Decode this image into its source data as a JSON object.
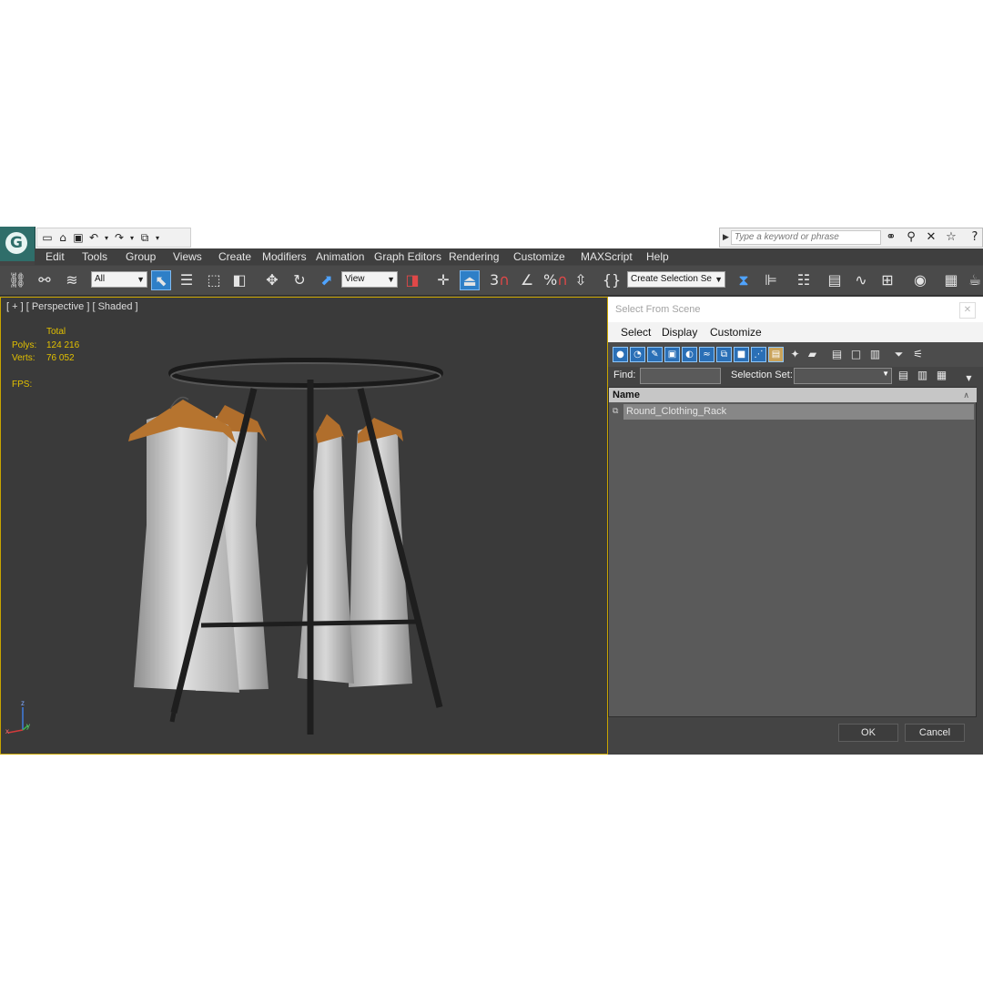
{
  "quick_access": {
    "icons": [
      "new-file-icon",
      "open-folder-icon",
      "save-icon",
      "undo-icon",
      "redo-icon",
      "project-folder-icon"
    ],
    "search_placeholder": "Type a keyword or phrase"
  },
  "menu": {
    "items": [
      "Edit",
      "Tools",
      "Group",
      "Views",
      "Create",
      "Modifiers",
      "Animation",
      "Graph Editors",
      "Rendering",
      "Customize",
      "MAXScript",
      "Help"
    ]
  },
  "toolbar": {
    "selection_filter": "All",
    "reference_coord": "View",
    "named_selection": "Create Selection Se",
    "snap_labels": {
      "snap3": "3",
      "percent": "%"
    }
  },
  "viewport": {
    "label": "[ + ] [ Perspective ] [ Shaded ]",
    "stats": {
      "total_label": "Total",
      "polys_label": "Polys:",
      "polys_value": "124 216",
      "verts_label": "Verts:",
      "verts_value": "76 052",
      "fps_label": "FPS:"
    },
    "axes": {
      "x": "x",
      "y": "y",
      "z": "z"
    }
  },
  "dialog": {
    "title": "Select From Scene",
    "menu": [
      "Select",
      "Display",
      "Customize"
    ],
    "find_label": "Find:",
    "selection_set_label": "Selection Set:",
    "column_header": "Name",
    "items": [
      {
        "name": "Round_Clothing_Rack"
      }
    ],
    "ok_label": "OK",
    "cancel_label": "Cancel"
  },
  "colors": {
    "viewport_bg": "#3a3a3a",
    "viewport_border": "#c8a400",
    "stats_text": "#e2c000",
    "active_button": "#2e7fc7",
    "selected_row": "#878787"
  }
}
